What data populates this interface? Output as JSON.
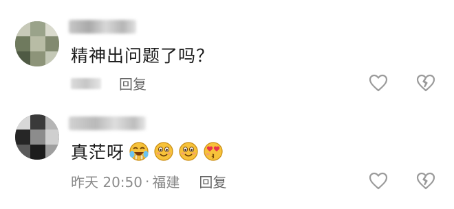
{
  "comments": [
    {
      "text": "精神出问题了吗？",
      "reply_label": "回复",
      "icons": [
        "avatar",
        "heart-outline-icon",
        "broken-heart-icon"
      ]
    },
    {
      "text": "真茫呀",
      "emojis": [
        "crying-laughing-face-emoji",
        "smiling-face-emoji",
        "smiling-face-emoji",
        "heart-eyes-face-emoji"
      ],
      "timestamp": "昨天 20:50",
      "separator": "·",
      "location": "福建",
      "reply_label": "回复",
      "icons": [
        "avatar",
        "heart-outline-icon",
        "broken-heart-icon"
      ]
    }
  ],
  "colors": {
    "text": "#1a1a1a",
    "meta": "#8a8a8a",
    "emoji_yellow": "#f7c23a",
    "icon_gray": "#9a9a9a"
  }
}
